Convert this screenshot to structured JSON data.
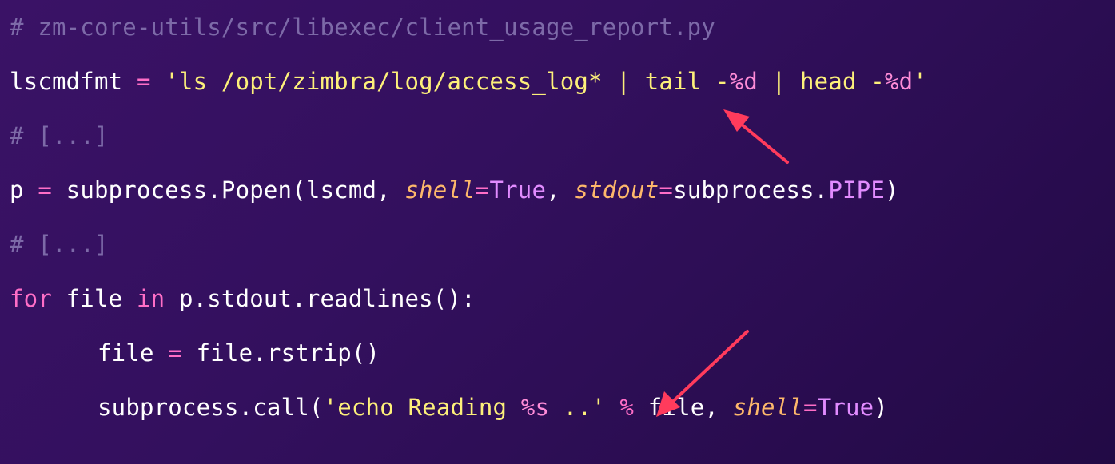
{
  "lines": {
    "l1": {
      "comment": "# zm-core-utils/src/libexec/client_usage_report.py"
    },
    "l2": {
      "var": "lscmdfmt",
      "eq": " = ",
      "str1": "'ls /opt/zimbra/log/access_log* | tail -",
      "fmt1": "%d",
      "str2": " | head -",
      "fmt2": "%d",
      "str3": "'"
    },
    "l3": {
      "comment": "# [...]"
    },
    "l4": {
      "var": "p",
      "eq": " = ",
      "call": "subprocess.Popen(lscmd, ",
      "kw1": "shell",
      "eq1": "=",
      "val1": "True",
      "sep": ", ",
      "kw2": "stdout",
      "eq2": "=",
      "val2pre": "subprocess.",
      "val2": "PIPE",
      "close": ")"
    },
    "l5": {
      "comment": "# [...]"
    },
    "l6": {
      "kw_for": "for",
      "var": " file ",
      "kw_in": "in",
      "rest": " p.stdout.readlines():"
    },
    "l7": {
      "var": "file",
      "eq": " = ",
      "rest": "file.rstrip()"
    },
    "l8": {
      "call": "subprocess.call(",
      "str1": "'echo Reading ",
      "fmt1": "%s",
      "str2": " ..'",
      "op": " % ",
      "arg": "file, ",
      "kw1": "shell",
      "eq1": "=",
      "val1": "True",
      "close": ")"
    }
  },
  "annotations": {
    "arrow_color": "#ff3b5c"
  }
}
